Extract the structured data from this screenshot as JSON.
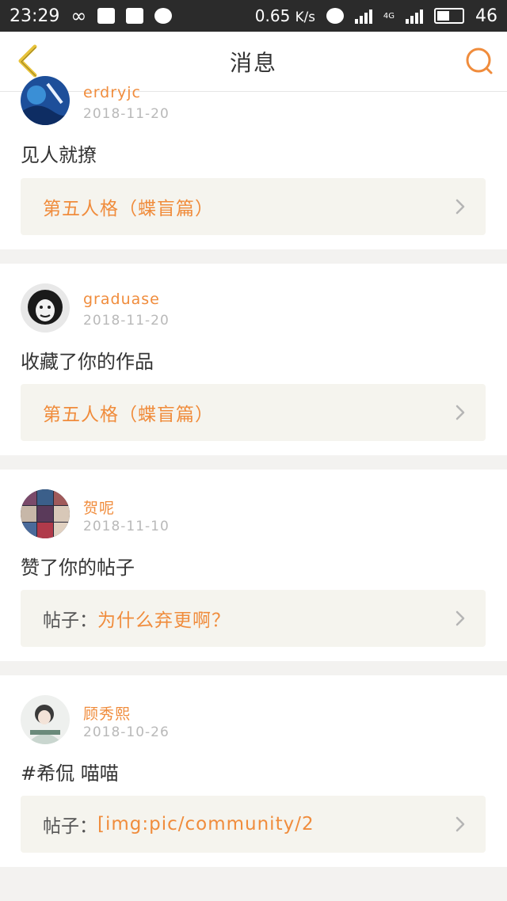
{
  "status_bar": {
    "time": "23:29",
    "speed": "0.65",
    "speed_unit": "K/s",
    "net_label": "4G",
    "battery": "46"
  },
  "header": {
    "title": "消息",
    "back_icon": "chevron-left-icon",
    "search_icon": "search-icon"
  },
  "colors": {
    "accent": "#f08c3c",
    "back_arrow": "#e8c33a",
    "ref_bg": "#f5f4ee",
    "text": "#333333",
    "muted": "#b9b9b9"
  },
  "messages": [
    {
      "username": "erdryjc",
      "date": "2018-11-20",
      "content": "见人就撩",
      "ref_prefix": "",
      "ref_text": "第五人格（蝶盲篇）"
    },
    {
      "username": "graduase",
      "date": "2018-11-20",
      "content": "收藏了你的作品",
      "ref_prefix": "",
      "ref_text": "第五人格（蝶盲篇）"
    },
    {
      "username": "贺呢",
      "date": "2018-11-10",
      "content": "赞了你的帖子",
      "ref_prefix": "帖子：",
      "ref_text": "为什么弃更啊？"
    },
    {
      "username": "顾秀熙",
      "date": "2018-10-26",
      "content": "#希侃 喵喵",
      "ref_prefix": "帖子：",
      "ref_text": "[img:pic/community/2"
    }
  ]
}
